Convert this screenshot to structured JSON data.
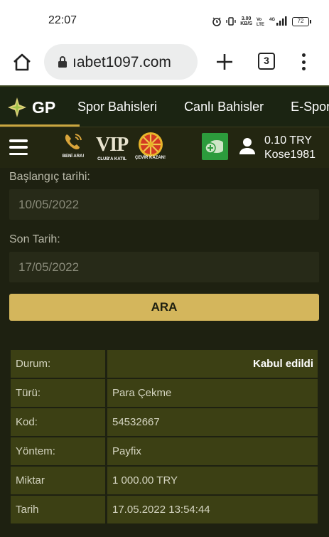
{
  "statusbar": {
    "time": "22:07",
    "net_speed_top": "3.00",
    "net_speed_bottom": "KB/S",
    "battery": "72"
  },
  "browser": {
    "url": "ıabet1097.com",
    "tab_count": "3"
  },
  "nav": {
    "logo": "GP",
    "links": [
      "Spor Bahisleri",
      "Canlı Bahisler",
      "E-Spor"
    ]
  },
  "header": {
    "promos": [
      "BENİ ARA!",
      "CLUB'A KATIL",
      "ÇEVİR KAZAN!"
    ],
    "vip": "VIP",
    "balance": "0.10 TRY",
    "username": "Kose1981"
  },
  "filter": {
    "start_label": "Başlangıç tarihi:",
    "start_value": "10/05/2022",
    "end_label": "Son Tarih:",
    "end_value": "17/05/2022",
    "search_button": "ARA"
  },
  "details": [
    {
      "key": "Durum:",
      "value": "Kabul edildi"
    },
    {
      "key": "Türü:",
      "value": "Para Çekme"
    },
    {
      "key": "Kod:",
      "value": "54532667"
    },
    {
      "key": "Yöntem:",
      "value": "Payfix"
    },
    {
      "key": "Miktar",
      "value": "1 000.00 TRY"
    },
    {
      "key": "Tarih",
      "value": "17.05.2022 13:54:44"
    }
  ],
  "colors": {
    "accent": "#d4b65c",
    "nav_bg": "#1b2412",
    "table_cell": "#3c4014",
    "cash_button": "#2c9b3c"
  }
}
